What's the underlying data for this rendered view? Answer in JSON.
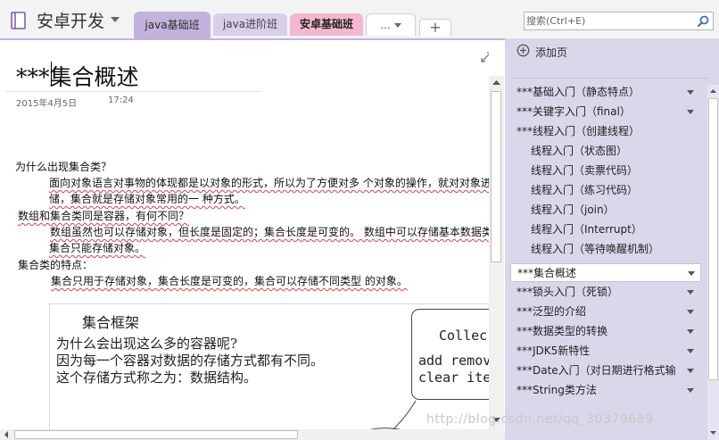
{
  "notebook": {
    "name": "安卓开发",
    "icon": "notebook-icon"
  },
  "sections": [
    {
      "label": "java基础班",
      "color": "#c2b3dd",
      "active": true
    },
    {
      "label": "java进阶班",
      "color": "#d9cfe9",
      "active": false
    },
    {
      "label": "安卓基础班",
      "color": "#f3b8cf",
      "active": false
    }
  ],
  "more_sections_label": "...",
  "add_section_label": "+",
  "search": {
    "placeholder": "搜索(Ctrl+E)",
    "icon": "search-icon"
  },
  "page": {
    "title": "***集合概述",
    "date": "2015年4月5日",
    "time": "17:24",
    "lines": [
      "为什么出现集合类？",
      "面向对象语言对事物的体现都是以对象的形式，所以为了方便对多 个对象的操作，就对对象进行存",
      "储，集合就是存储对象常用的一 种方式。",
      "数组和集合类同是容器，有何不同？",
      "数组虽然也可以存储对象，但长度是固定的；集合长度是可变的。 数组中可以存储基本数据类型，",
      "集合只能存储对象。",
      "集合类的特点：",
      "集合只用于存储对象，集合长度是可变的，集合可以存储不同类型 的对象。"
    ],
    "image": {
      "title": "集合框架",
      "lines": [
        "为什么会出现这么多的容器呢?",
        "因为每一个容器对数据的存储方式都有不同。",
        "这个存储方式称之为：数据结构。"
      ],
      "box_lines": [
        "Collec",
        "add remov",
        "clear ite"
      ]
    }
  },
  "pages_pane": {
    "add_page_label": "添加页",
    "items": [
      {
        "label": "***基础入门（静态特点）",
        "sub": false,
        "chevron": true,
        "selected": false
      },
      {
        "label": "***关键字入门（final）",
        "sub": false,
        "chevron": true,
        "selected": false
      },
      {
        "label": "***线程入门（创建线程）",
        "sub": false,
        "chevron": false,
        "selected": false
      },
      {
        "label": "线程入门（状态图）",
        "sub": true,
        "chevron": false,
        "selected": false
      },
      {
        "label": "线程入门（卖票代码）",
        "sub": true,
        "chevron": false,
        "selected": false
      },
      {
        "label": "线程入门（练习代码）",
        "sub": true,
        "chevron": false,
        "selected": false
      },
      {
        "label": "线程入门（join）",
        "sub": true,
        "chevron": false,
        "selected": false
      },
      {
        "label": "线程入门（Interrupt）",
        "sub": true,
        "chevron": false,
        "selected": false
      },
      {
        "label": "线程入门（等待唤醒机制）",
        "sub": true,
        "chevron": false,
        "selected": false
      },
      {
        "label": "***集合概述",
        "sub": false,
        "chevron": true,
        "selected": true
      },
      {
        "label": "***锁头入门（死锁）",
        "sub": false,
        "chevron": true,
        "selected": false
      },
      {
        "label": "***泛型的介绍",
        "sub": false,
        "chevron": true,
        "selected": false
      },
      {
        "label": "***数据类型的转换",
        "sub": false,
        "chevron": true,
        "selected": false
      },
      {
        "label": "***JDK5新特性",
        "sub": false,
        "chevron": true,
        "selected": false
      },
      {
        "label": "***Date入门（对日期进行格式输",
        "sub": false,
        "chevron": true,
        "selected": false
      },
      {
        "label": "***String类方法",
        "sub": false,
        "chevron": true,
        "selected": false
      }
    ]
  },
  "watermark": "http://blog.csdn.net/qq_30379689"
}
